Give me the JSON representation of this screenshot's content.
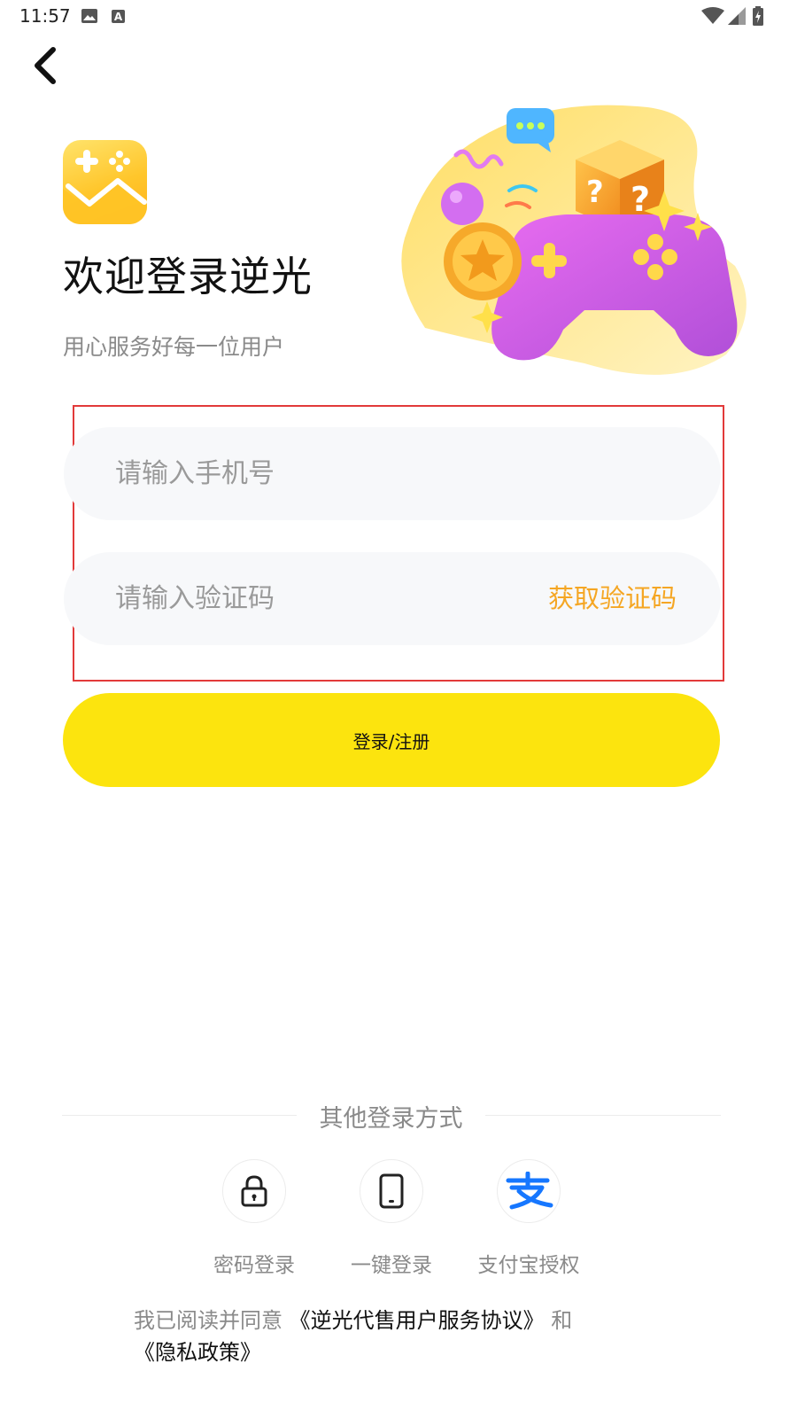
{
  "status_bar": {
    "time": "11:57",
    "a_badge": "A"
  },
  "header": {
    "title": "欢迎登录逆光",
    "subtitle": "用心服务好每一位用户"
  },
  "form": {
    "phone_placeholder": "请输入手机号",
    "code_placeholder": "请输入验证码",
    "get_code_label": "获取验证码",
    "submit_label": "登录/注册"
  },
  "other_login": {
    "title": "其他登录方式",
    "methods": [
      {
        "label": "密码登录",
        "icon": "lock-icon"
      },
      {
        "label": "一键登录",
        "icon": "phone-icon"
      },
      {
        "label": "支付宝授权",
        "icon": "alipay-icon"
      }
    ]
  },
  "agreement": {
    "prefix": "我已阅读并同意",
    "service_link": "《逆光代售用户服务协议》",
    "and": "和",
    "privacy_link": "《隐私政策》"
  },
  "colors": {
    "primary_button": "#fce40e",
    "get_code": "#f5a623",
    "highlight_border": "#e23a3a",
    "alipay_blue": "#1677ff",
    "field_bg": "#f7f8fa"
  }
}
